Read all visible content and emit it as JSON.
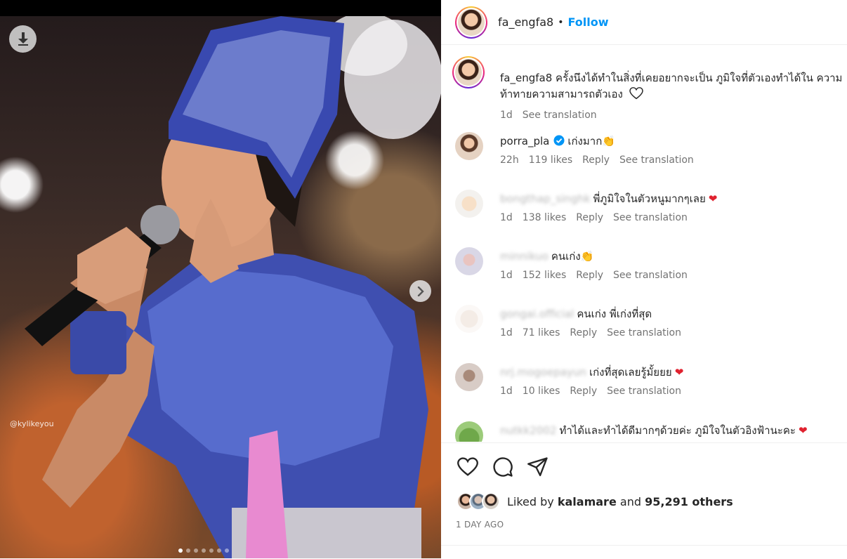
{
  "post": {
    "author": "fa_engfa8",
    "follow_label": "Follow",
    "separator": "•",
    "caption_text": "ครั้งนึงได้ทำในสิ่งที่เคยอยากจะเป็น ภูมิใจที่ตัวเองทำได้ใน ความท้าทายความสามารถตัวเอง",
    "caption_time": "1d",
    "see_translation": "See translation",
    "watermark": "@kylikeyou",
    "carousel": {
      "count": 7,
      "active_index": 0
    }
  },
  "comments": [
    {
      "user": "porra_pla",
      "verified": true,
      "blurred": false,
      "text": "เก่งมาก",
      "emoji": "👏",
      "time": "22h",
      "likes": "119 likes",
      "reply": "Reply",
      "translate": "See translation"
    },
    {
      "user": "bongthap_singhk",
      "verified": false,
      "blurred": true,
      "text": "พี่ภูมิใจในตัวหนูมากๆเลย",
      "emoji": "❤",
      "time": "1d",
      "likes": "138 likes",
      "reply": "Reply",
      "translate": "See translation"
    },
    {
      "user": "minnikuo",
      "verified": false,
      "blurred": true,
      "text": "คนเก่ง",
      "emoji": "👏",
      "time": "1d",
      "likes": "152 likes",
      "reply": "Reply",
      "translate": "See translation"
    },
    {
      "user": "gongai.official",
      "verified": false,
      "blurred": true,
      "text": "คนเก่ง พี่เก่งที่สุด",
      "emoji": "",
      "time": "1d",
      "likes": "71 likes",
      "reply": "Reply",
      "translate": "See translation"
    },
    {
      "user": "nrj.mogoepayun",
      "verified": false,
      "blurred": true,
      "text": "เก่งที่สุดเลยรู้มั้ยยย",
      "emoji": "❤",
      "time": "1d",
      "likes": "10 likes",
      "reply": "Reply",
      "translate": "See translation"
    },
    {
      "user": "nutkk2002",
      "verified": false,
      "blurred": true,
      "text": "ทำได้และทำได้ดีมากๆด้วยค่ะ ภูมิใจในตัวอิงฟ้านะคะ",
      "emoji": "❤",
      "time": "",
      "likes": "",
      "reply": "",
      "translate": ""
    }
  ],
  "actions": {
    "icons": [
      "heart-icon",
      "comment-icon",
      "share-icon"
    ],
    "liked_by_prefix": "Liked by",
    "liked_by_user": "kalamare",
    "liked_by_and": "and",
    "liked_by_others": "95,291 others",
    "timestamp": "1 DAY AGO"
  },
  "colors": {
    "accent": "#0095f6",
    "text": "#262626",
    "muted": "#737373",
    "heart": "#e0222f"
  }
}
